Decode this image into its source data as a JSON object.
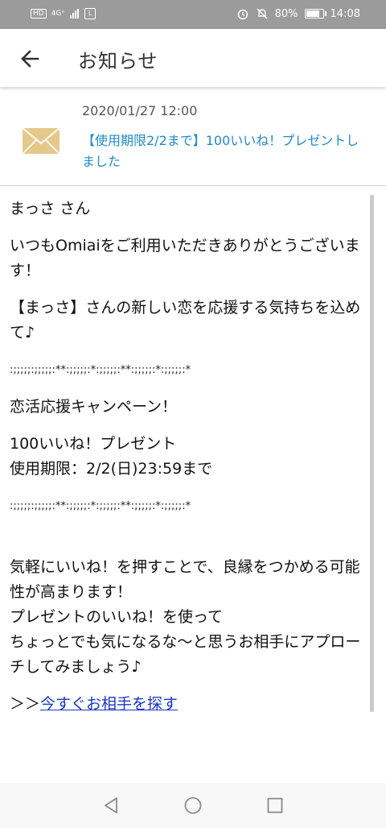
{
  "status_bar": {
    "hd": "HD",
    "network": "4G⁺",
    "battery_percent": "80%",
    "battery_level": 0.8,
    "time": "14:08"
  },
  "app_bar": {
    "title": "お知らせ"
  },
  "notice": {
    "date": "2020/01/27 12:00",
    "subject": "【使用期限2/2まで】100いいね！プレゼントしました"
  },
  "body": {
    "greeting": "まっさ さん",
    "para1": "いつもOmiaiをご利用いただきありがとうございます！",
    "para2": "【まっさ】さんの新しい恋を応援する気持ちを込めて♪",
    "deco1": ":;;;;;:;;;;;:**:;;;;;:*:;;;;;:**:;;;;;:*:;;;;;:*",
    "campaign": "恋活応援キャンペーン！",
    "present_line": "100いいね！プレゼント",
    "expiry_line": "使用期限：2/2(日)23:59まで",
    "deco2": ":;;;;;:;;;;;:**:;;;;;:*:;;;;;:**:;;;;;:*:;;;;;:*",
    "para3_line1": "気軽にいいね！を押すことで、良縁をつかめる可能性が高まります！",
    "para3_line2": "プレゼントのいいね！を使って",
    "para3_line3": "ちょっとでも気になるな〜と思うお相手にアプローチしてみましょう♪",
    "cta_prefix": "＞＞",
    "cta_link": "今すぐお相手を探す"
  },
  "colors": {
    "subject": "#1f8aca",
    "link": "#1a36c7",
    "mail_icon": "#e6c98a"
  }
}
